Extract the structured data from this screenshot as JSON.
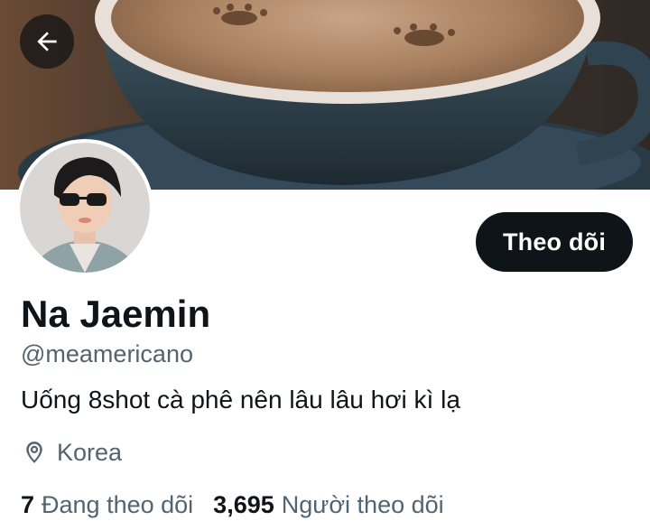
{
  "header": {
    "back_icon": "arrow-left-icon"
  },
  "profile": {
    "display_name": "Na Jaemin",
    "handle": "@meamericano",
    "bio": "Uống 8shot cà phê nên lâu lâu hơi kì lạ",
    "location": "Korea",
    "location_icon": "map-pin-icon",
    "follow_label": "Theo dõi"
  },
  "stats": {
    "following_count": "7",
    "following_label": "Đang theo dõi",
    "followers_count": "3,695",
    "followers_label": "Người theo dõi"
  },
  "colors": {
    "primary_text": "#0f1419",
    "secondary_text": "#536471",
    "follow_button_bg": "#0f1419",
    "follow_button_text": "#ffffff",
    "background": "#ffffff"
  }
}
